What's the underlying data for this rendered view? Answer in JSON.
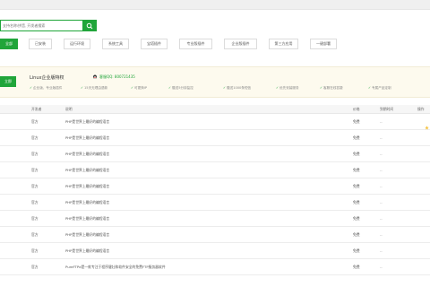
{
  "search": {
    "placeholder": "支持名称/拼音, 开发者搜索"
  },
  "tabs": [
    "全部",
    "已安装",
    "运行环境",
    "系统工具",
    "宝塔插件",
    "专业版插件",
    "企业版插件",
    "第三方应用",
    "一键部署"
  ],
  "banner": {
    "button_label": "立即",
    "title": "Linux企业版特权",
    "qq_label": "客服QQ: 800721435",
    "features": [
      "企业版、专业版插件",
      "15天无理由退款",
      "可更换IP",
      "赠送5分钟监控",
      "赠送1000条短信",
      "优先安装服务",
      "客服在线答疑",
      "专属产品定制"
    ]
  },
  "table": {
    "headers": [
      "开发者",
      "说明",
      "价格",
      "到期时间",
      "操作"
    ],
    "rows": [
      {
        "dev": "官方",
        "desc": "PHP是世界上最好的编程语言",
        "price": "免费",
        "expire": "--"
      },
      {
        "dev": "官方",
        "desc": "PHP是世界上最好的编程语言",
        "price": "免费",
        "expire": "--"
      },
      {
        "dev": "官方",
        "desc": "PHP是世界上最好的编程语言",
        "price": "免费",
        "expire": "--"
      },
      {
        "dev": "官方",
        "desc": "PHP是世界上最好的编程语言",
        "price": "免费",
        "expire": "--"
      },
      {
        "dev": "官方",
        "desc": "PHP是世界上最好的编程语言",
        "price": "免费",
        "expire": "--"
      },
      {
        "dev": "官方",
        "desc": "PHP是世界上最好的编程语言",
        "price": "免费",
        "expire": "--"
      },
      {
        "dev": "官方",
        "desc": "PHP是世界上最好的编程语言",
        "price": "免费",
        "expire": "--"
      },
      {
        "dev": "官方",
        "desc": "PHP是世界上最好的编程语言",
        "price": "免费",
        "expire": "--"
      },
      {
        "dev": "官方",
        "desc": "PHP是世界上最好的编程语言",
        "price": "免费",
        "expire": "--"
      },
      {
        "dev": "官方",
        "desc": "PureFTPd是一款专注于程序健壮和软件安全的免费FTP服务器软件",
        "price": "免费",
        "expire": "--"
      }
    ]
  },
  "colors": {
    "accent": "#20a53a",
    "banner_bg": "#fdfaee",
    "star": "#f5c242"
  },
  "icons": {
    "search": "search-icon",
    "qq": "qq-icon",
    "check": "check-icon",
    "star": "star-icon"
  }
}
